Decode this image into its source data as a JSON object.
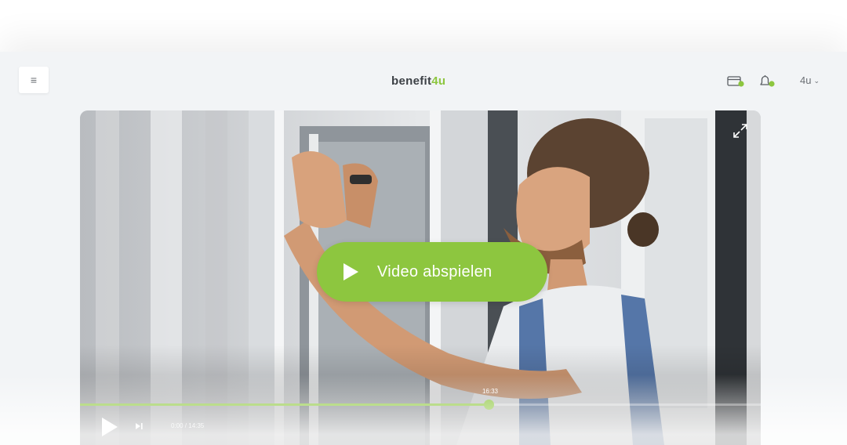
{
  "header": {
    "logo_part1": "benefit",
    "logo_part2": "4u",
    "user_label": "4u",
    "icons": [
      "menu-icon",
      "wallet-icon",
      "bell-icon",
      "chevron-down-icon"
    ]
  },
  "video": {
    "play_label": "Video abspielen",
    "hover_time": "16:33",
    "time_display": "0:00 / 14:35",
    "progress": 0.6,
    "icons": [
      "fullscreen-icon",
      "play-icon",
      "skip-next-icon"
    ]
  },
  "colors": {
    "accent": "#8dc63f",
    "logo_dark": "#3d4146",
    "app_bg": "#f2f4f6"
  }
}
